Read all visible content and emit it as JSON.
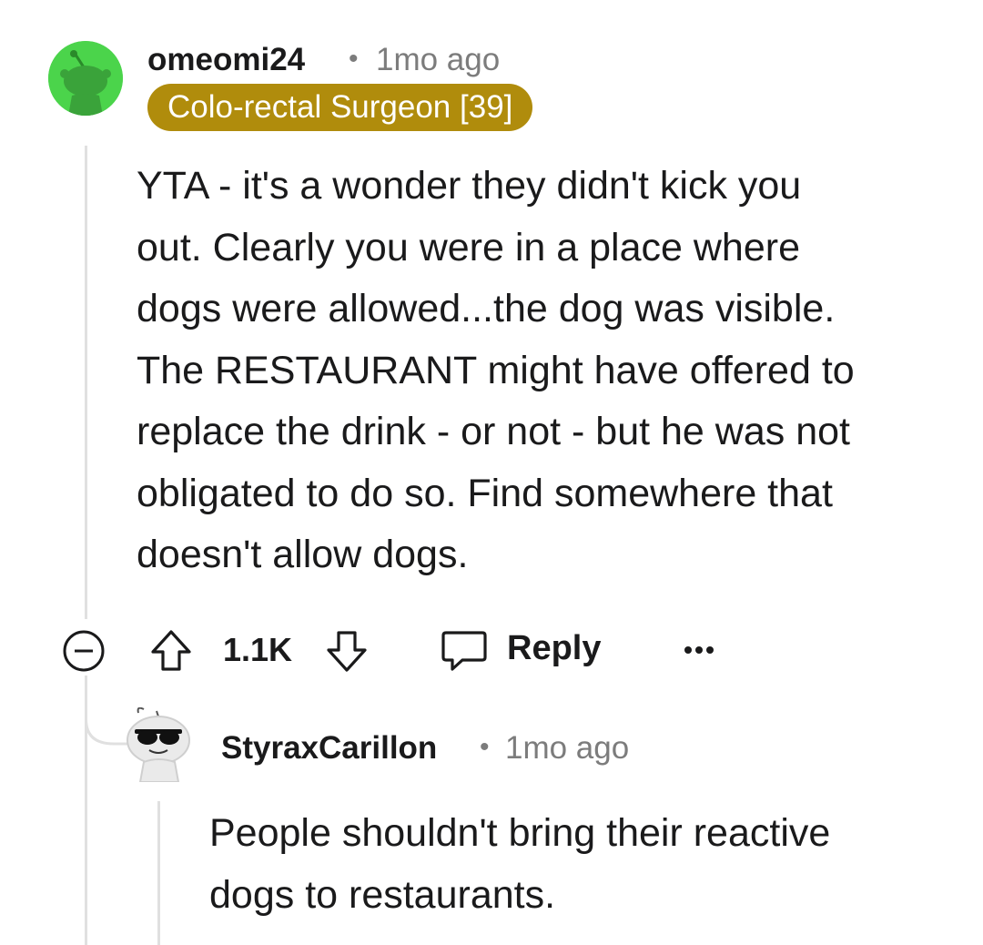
{
  "comment": {
    "username": "omeomi24",
    "separator": "•",
    "time": "1mo ago",
    "flair": "Colo-rectal Surgeon [39]",
    "body_lines": [
      "YTA - it's a wonder they didn't kick you",
      "out. Clearly you were in a place where",
      "dogs were allowed...the dog was visible.",
      "The RESTAURANT might have offered to",
      "replace the drink - or not - but he was not",
      "obligated to do so. Find somewhere that",
      "doesn't allow dogs."
    ],
    "vote_count": "1.1K",
    "reply_label": "Reply",
    "avatar_color": "#4bd44b",
    "flair_color": "#b08c0c"
  },
  "reply": {
    "username": "StyraxCarillon",
    "separator": "•",
    "time": "1mo ago",
    "body_lines": [
      "People shouldn't bring their reactive",
      "dogs to restaurants."
    ]
  },
  "icons": [
    "collapse-icon",
    "upvote-icon",
    "downvote-icon",
    "comment-icon",
    "more-options-icon"
  ]
}
